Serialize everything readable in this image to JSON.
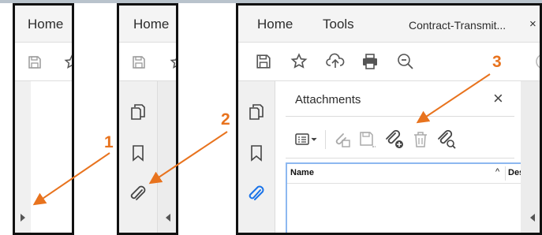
{
  "panel1": {
    "menu_home": "Home"
  },
  "panel2": {
    "menu_home": "Home"
  },
  "panel3": {
    "menu_home": "Home",
    "menu_tools": "Tools",
    "document_tab": "Contract-Transmit...",
    "attachments_panel": {
      "title": "Attachments",
      "columns": [
        "Name",
        "Des"
      ]
    }
  },
  "callouts": [
    "1",
    "2",
    "3"
  ],
  "icons": {
    "toolbar": [
      "save-icon",
      "star-icon",
      "upload-icon",
      "print-icon",
      "zoom-out-icon"
    ],
    "nav": [
      "pages-icon",
      "bookmark-icon",
      "paperclip-icon"
    ],
    "attachments_toolbar": [
      "list-options-icon",
      "open-attachment-icon",
      "save-attachment-icon",
      "add-attachment-icon",
      "delete-icon",
      "search-attachment-icon"
    ]
  },
  "colors": {
    "callout": "#e8731e",
    "active_icon": "#1a73e8",
    "list_border": "#8db8f0",
    "panel_border": "#111111"
  }
}
